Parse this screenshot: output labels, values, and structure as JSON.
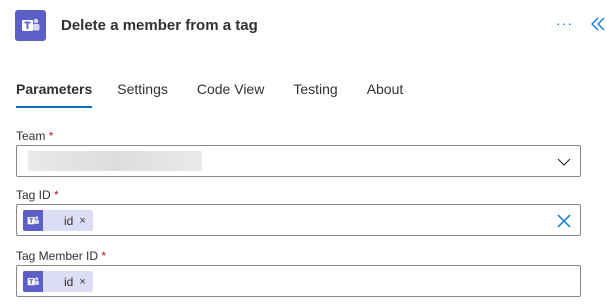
{
  "header": {
    "title": "Delete a member from a tag",
    "app_icon": "teams-icon",
    "more_label": "···",
    "collapse_icon": "double-chevron-left-icon"
  },
  "tabs": [
    {
      "label": "Parameters",
      "active": true
    },
    {
      "label": "Settings",
      "active": false
    },
    {
      "label": "Code View",
      "active": false
    },
    {
      "label": "Testing",
      "active": false
    },
    {
      "label": "About",
      "active": false
    }
  ],
  "fields": {
    "team": {
      "label": "Team",
      "required_mark": "*",
      "value": "",
      "control": "dropdown"
    },
    "tag_id": {
      "label": "Tag ID",
      "required_mark": "*",
      "token_label": "id",
      "token_remove": "×",
      "clear_icon": "clear-x-icon"
    },
    "tag_member_id": {
      "label": "Tag Member ID",
      "required_mark": "*",
      "token_label": "id",
      "token_remove": "×"
    }
  },
  "colors": {
    "accent": "#0078d4",
    "teams_brand": "#5b5fc7",
    "token_bg": "#dcdcf4",
    "required": "#a4262c"
  }
}
